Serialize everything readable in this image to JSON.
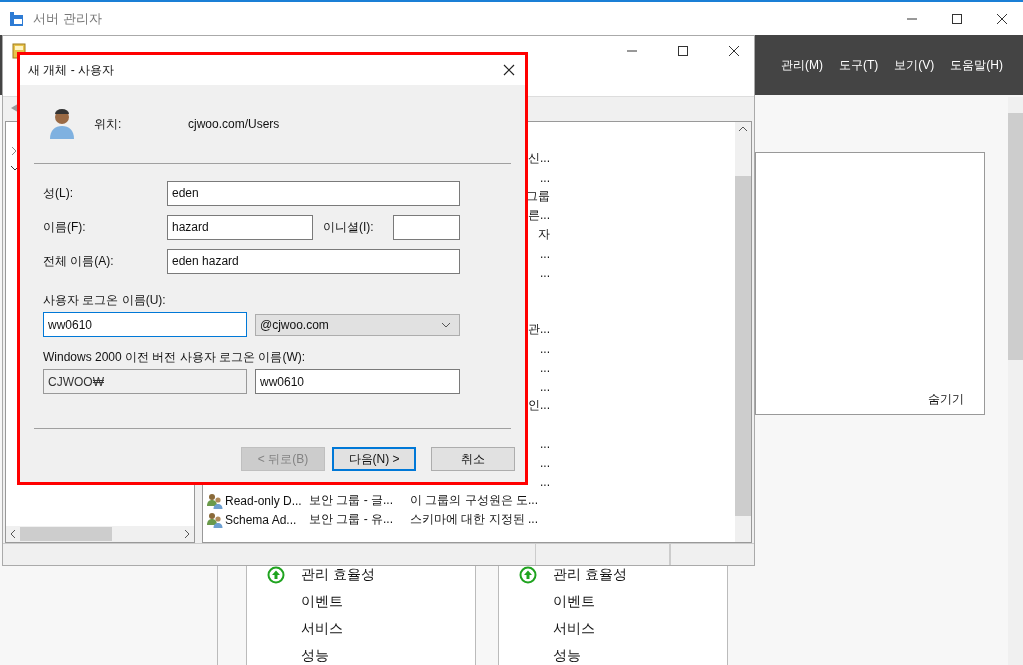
{
  "server_manager": {
    "title": "서버 관리자",
    "menu": [
      "관리(M)",
      "도구(T)",
      "보기(V)",
      "도움말(H)"
    ],
    "panel": {
      "hide_link": "숨기기"
    },
    "tiles": [
      {
        "items": [
          {
            "label": "관리 효율성",
            "ok": true
          },
          {
            "label": "이벤트",
            "ok": false
          },
          {
            "label": "서비스",
            "ok": false
          },
          {
            "label": "성능",
            "ok": false
          }
        ]
      },
      {
        "items": [
          {
            "label": "관리 효율성",
            "ok": true
          },
          {
            "label": "이벤트",
            "ok": false
          },
          {
            "label": "서비스",
            "ok": false
          },
          {
            "label": "성능",
            "ok": false
          }
        ]
      }
    ]
  },
  "aduc_window": {
    "row_groups": [
      [
        {
          "description": "신..."
        },
        {
          "description": "..."
        },
        {
          "description": "그룹"
        },
        {
          "description": "른..."
        },
        {
          "description": "자"
        },
        {
          "description": "..."
        },
        {
          "description": "..."
        }
      ],
      [
        {
          "description": "관..."
        },
        {
          "description": "..."
        },
        {
          "description": "..."
        },
        {
          "description": "..."
        },
        {
          "description": "인..."
        }
      ],
      [
        {
          "description": "..."
        },
        {
          "description": "..."
        },
        {
          "description": "..."
        },
        {
          "name": "Read-only D...",
          "type": "보안 그룹 - 글...",
          "description": "이 그룹의 구성원은 도...",
          "kind": "group"
        },
        {
          "name": "Schema Ad...",
          "type": "보안 그룹 - 유...",
          "description": "스키마에 대한 지정된 ...",
          "kind": "group"
        }
      ]
    ]
  },
  "dialog": {
    "title": "새 개체 - 사용자",
    "location_label": "위치:",
    "location": "cjwoo.com/Users",
    "last_name": {
      "label": "성(L):",
      "value": "eden"
    },
    "first_name": {
      "label": "이름(F):",
      "value": "hazard"
    },
    "initials": {
      "label": "이니셜(I):"
    },
    "full_name": {
      "label": "전체 이름(A):",
      "value": "eden hazard"
    },
    "logon": {
      "label": "사용자 로그온 이름(U):",
      "value": "ww0610",
      "focused": true,
      "domain": "@cjwoo.com"
    },
    "legacy_logon": {
      "label": "Windows 2000 이전 버전 사용자 로그온 이름(W):",
      "domain": "CJWOO₩",
      "value": "ww0610"
    },
    "buttons": [
      {
        "label": "< 뒤로(B)",
        "disabled": true,
        "default": false
      },
      {
        "label": "다음(N) >",
        "disabled": false,
        "default": true
      },
      {
        "label": "취소",
        "disabled": false,
        "default": false
      }
    ]
  }
}
